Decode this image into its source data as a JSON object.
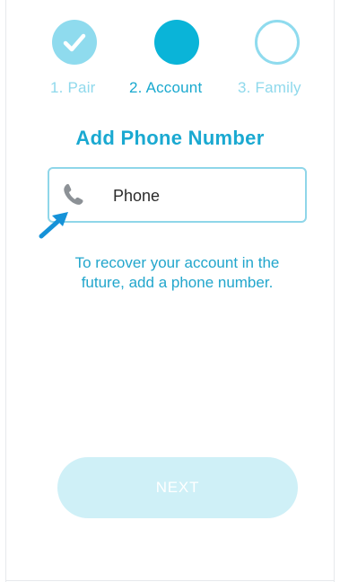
{
  "stepper": {
    "steps": [
      {
        "label": "1. Pair",
        "state": "completed",
        "icon": "checkmark-icon"
      },
      {
        "label": "2. Account",
        "state": "current"
      },
      {
        "label": "3. Family",
        "state": "upcoming"
      }
    ]
  },
  "title": "Add Phone Number",
  "phone_field": {
    "placeholder": "Phone",
    "value": "",
    "icon": "phone-icon"
  },
  "help_text": "To recover your account in the future, add a phone number.",
  "next_button": {
    "label": "NEXT",
    "state": "disabled"
  },
  "colors": {
    "accent": "#19a9cf",
    "accent_light": "#8fdbee",
    "button_disabled": "#cff0f7"
  }
}
